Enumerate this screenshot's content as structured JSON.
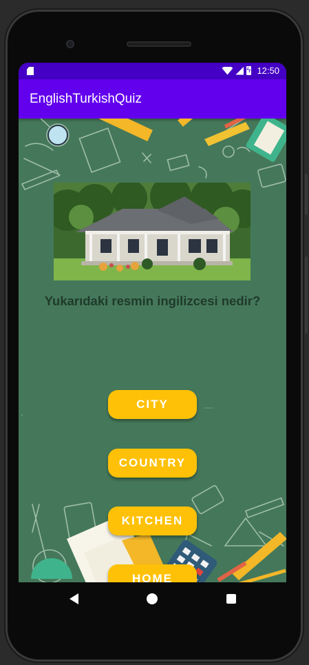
{
  "status_bar": {
    "time": "12:50",
    "icons": [
      "sd-card-icon",
      "wifi-icon",
      "signal-icon",
      "battery-charging-icon"
    ]
  },
  "app_bar": {
    "title": "EnglishTurkishQuiz"
  },
  "quiz": {
    "image_icon": "house-photo",
    "question": "Yukarıdaki resmin ingilizcesi nedir?",
    "options": [
      "CITY",
      "COUNTRY",
      "KITCHEN",
      "HOME"
    ]
  },
  "nav_bar": {
    "icons": [
      "back-icon",
      "home-icon",
      "recents-icon"
    ]
  },
  "colors": {
    "status_bar": "#4400c4",
    "app_bar": "#6200ee",
    "background": "#45785a",
    "button": "#ffc107"
  }
}
